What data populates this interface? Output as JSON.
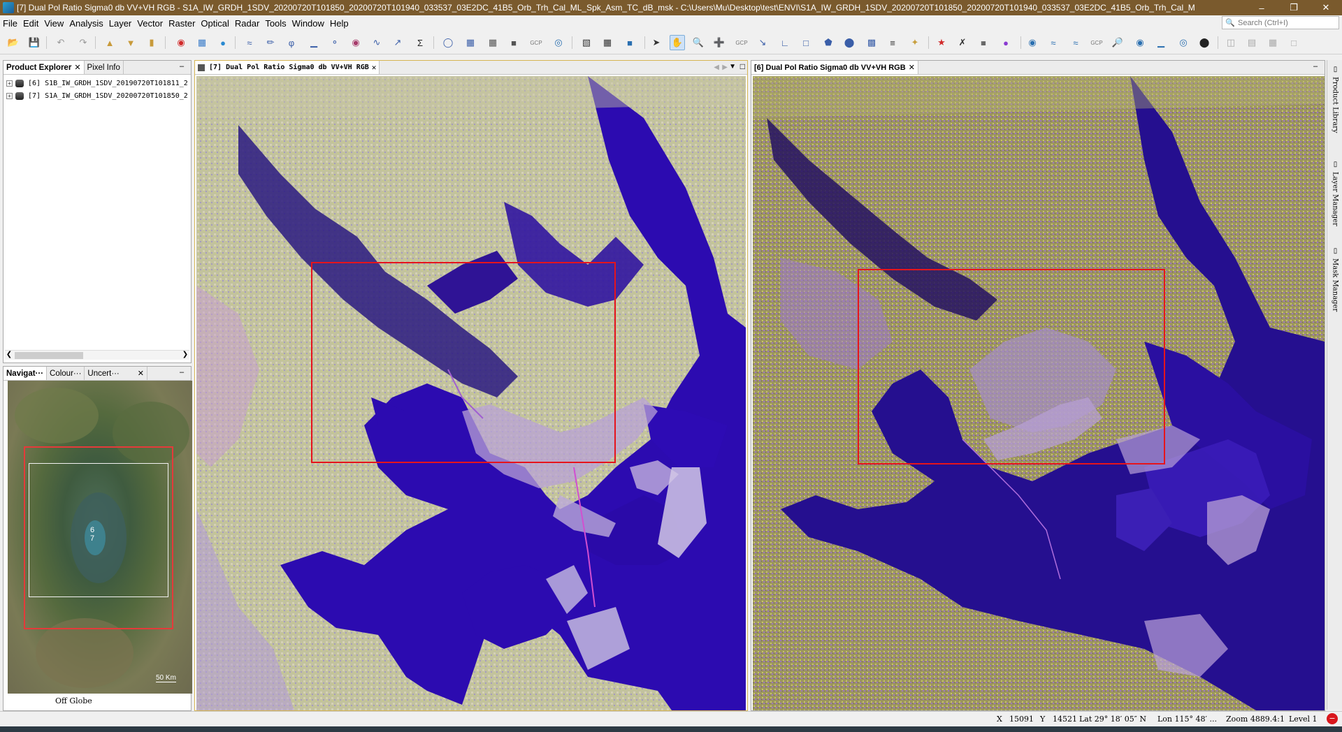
{
  "window": {
    "title": "[7] Dual Pol Ratio Sigma0 db VV+VH RGB - S1A_IW_GRDH_1SDV_20200720T101850_20200720T101940_033537_03E2DC_41B5_Orb_Trh_Cal_ML_Spk_Asm_TC_dB_msk - C:\\Users\\Mu\\Desktop\\test\\ENVI\\S1A_IW_GRDH_1SDV_20200720T101850_20200720T101940_033537_03E2DC_41B5_Orb_Trh_Cal_M",
    "minimize": "–",
    "restore": "❐",
    "close": "✕"
  },
  "menu": {
    "items": [
      "File",
      "Edit",
      "View",
      "Analysis",
      "Layer",
      "Vector",
      "Raster",
      "Optical",
      "Radar",
      "Tools",
      "Window",
      "Help"
    ],
    "search_placeholder": "Search (Ctrl+I)"
  },
  "toolbar": {
    "gcp_label": "GCP",
    "icons": [
      "open-product-icon",
      "save-product-icon",
      "undo-icon",
      "redo-icon",
      "import-icon",
      "export-icon",
      "band-icon",
      "rgb-icon",
      "filter-icon",
      "stats-icon",
      "line-tool-icon",
      "draw-icon",
      "band-maths-icon",
      "histogram-icon",
      "scatter-icon",
      "profile-icon",
      "spectrum-icon",
      "sum-icon",
      "graph-icon",
      "batch-icon",
      "grid-icon",
      "gcp-icon",
      "globe-icon",
      "graph-builder-icon",
      "ioi-icon",
      "select-tool-icon",
      "pan-tool-icon",
      "zoom-tool-icon",
      "magnifier-icon",
      "line-draw-icon",
      "polyline-icon",
      "rectangle-icon",
      "polygon-icon",
      "ellipse-icon",
      "insert-icon",
      "range-finder-icon",
      "pin-icon",
      "wand-icon",
      "layer-icon",
      "world-icon",
      "eye-icon",
      "tile-icon"
    ]
  },
  "product_explorer": {
    "tabs": [
      {
        "label": "Product Explorer",
        "active": true,
        "closable": true
      },
      {
        "label": "Pixel Info",
        "active": false,
        "closable": false
      }
    ],
    "items": [
      {
        "label": "[6] S1B_IW_GRDH_1SDV_20190720T101811_2"
      },
      {
        "label": "[7] S1A_IW_GRDH_1SDV_20200720T101850_2"
      }
    ]
  },
  "navigation": {
    "tabs": [
      {
        "label": "Navigat···"
      },
      {
        "label": "Colour···"
      },
      {
        "label": "Uncert···"
      }
    ],
    "overlay_labels": [
      "6",
      "7"
    ],
    "scale_label": "50 Km",
    "footer": "Off Globe"
  },
  "views": {
    "left": {
      "label": "[7] Dual Pol Ratio Sigma0 db VV+VH RGB"
    },
    "right": {
      "label": "[6] Dual Pol Ratio Sigma0 db VV+VH RGB"
    }
  },
  "right_sidebar": {
    "tabs": [
      "Product Library",
      "Layer Manager",
      "Mask Manager"
    ]
  },
  "status": {
    "x_label": "X",
    "x_value": "15091",
    "y_label": "Y",
    "y_value": "14521",
    "lat": "Lat 29° 18′ 05″ N",
    "lon": "Lon 115° 48′ ...",
    "zoom": "Zoom 4889.4:1",
    "level": "Level 1"
  },
  "colors": {
    "title_bar": "#7a5a2d",
    "selection_box": "#e6141c",
    "water": "#2a0aa8"
  }
}
